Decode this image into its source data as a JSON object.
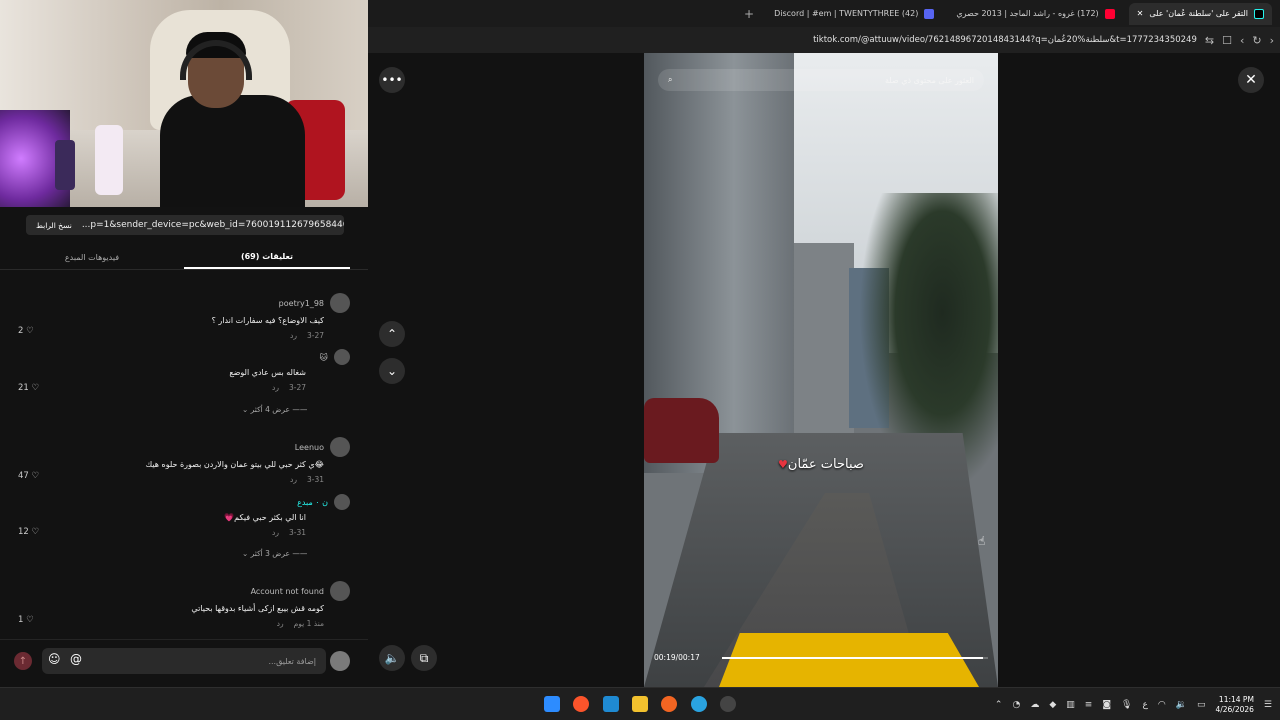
{
  "browser": {
    "tabs": [
      {
        "label": "(42) Discord | #em | TWENTYTHREE",
        "active": false
      },
      {
        "label": "(172) غروه - راشد الماجد | 2013 حصري",
        "active": false
      },
      {
        "label": "التقر على 'سلطنة عُمان' على",
        "active": true
      }
    ],
    "new_tab": "+",
    "url": "tiktok.com/@attuuw/video/7621489672014843144?q=سلطنة%20عُمان&t=1777234350249"
  },
  "left": {
    "copy_link_label": "نسخ الرابط",
    "share_link": "...p=1&sender_device=pc&web_id=7600191126796584464",
    "tab_videos": "فيديوهات المبدع",
    "tab_comments": "(69) تعليقات",
    "comments": [
      {
        "user": "poetry1_98",
        "text": "كيف الاوضاع؟ فيه سفارات اندار ؟",
        "date": "3-27",
        "reply": "رد",
        "likes": "2"
      },
      {
        "user": "🐱",
        "text": "شغاله بس عادي الوضع",
        "date": "3-27",
        "reply": "رد",
        "likes": "21"
      },
      {
        "user": "Leenuo",
        "text": "😂ي كثر حبي للي بيتو عمان والاردن بصورة حلوه هيك",
        "date": "3-31",
        "reply": "رد",
        "likes": "47"
      },
      {
        "user": "ن ٠ مبدع",
        "text": "انا الي بكثر حبي فيكم💗",
        "date": "3-31",
        "reply": "رد",
        "likes": "12"
      },
      {
        "user": "Account not found",
        "text": "كومه قش بيبع ازكى أشياء بدوقها بحياتي",
        "date": "منذ 1 يوم",
        "reply": "رد",
        "likes": "1"
      }
    ],
    "more_replies_1": "عرض 4 أكثر",
    "more_replies_2": "عرض 3 أكثر",
    "composer_placeholder": "إضافة تعليق...",
    "emoji_label": "☺",
    "at_label": "@",
    "send_label": "↑"
  },
  "video": {
    "search_text": "العثور على محتوى ذي صلة",
    "overlay_text": "صباحات عمّان",
    "time": "00:19/00:17",
    "progress": 0.98
  },
  "taskbar": {
    "time": "11:14 PM",
    "date": "4/26/2026",
    "lang": "ع"
  },
  "colors": {
    "accent": "#fe2c55",
    "heart": "#e8343f"
  }
}
